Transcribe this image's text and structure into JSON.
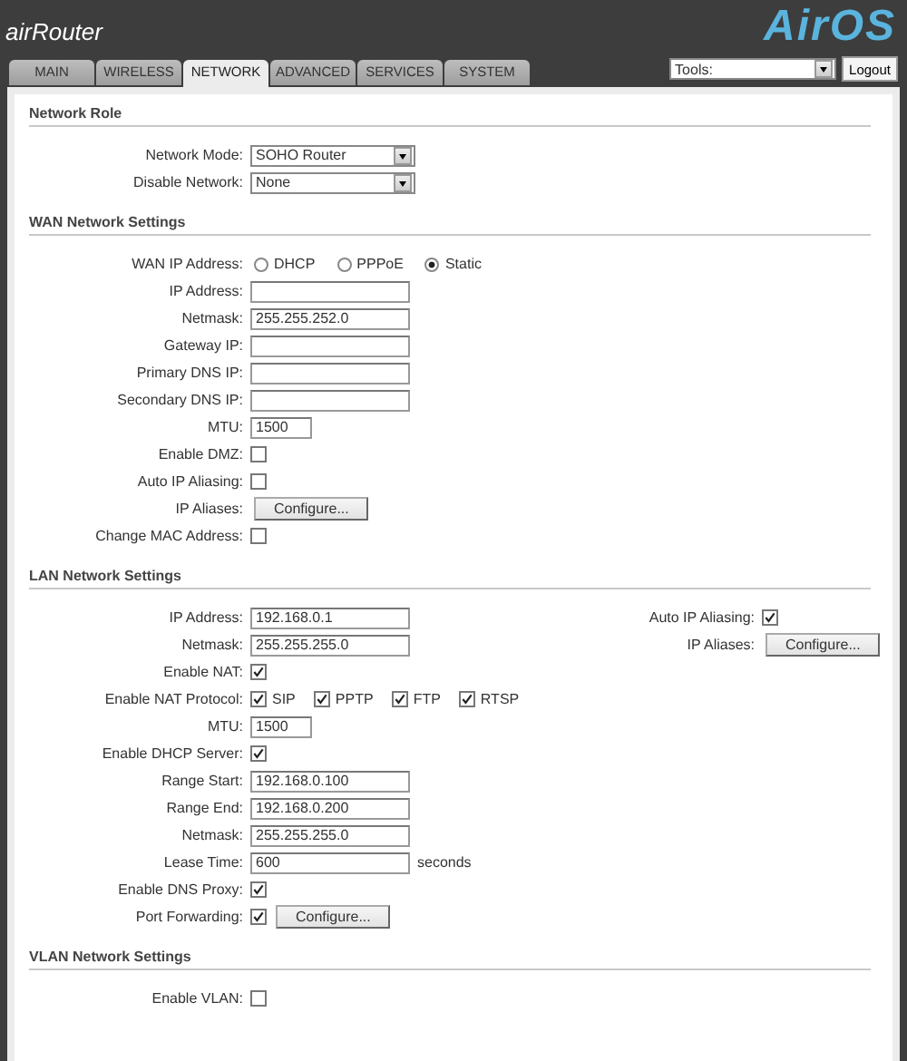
{
  "header": {
    "logo": "airRouter",
    "brand": "AirOS"
  },
  "tabs": [
    {
      "label": "MAIN",
      "selected": false
    },
    {
      "label": "WIRELESS",
      "selected": false
    },
    {
      "label": "NETWORK",
      "selected": true
    },
    {
      "label": "ADVANCED",
      "selected": false
    },
    {
      "label": "SERVICES",
      "selected": false
    },
    {
      "label": "SYSTEM",
      "selected": false
    }
  ],
  "tools": {
    "value": "Tools:"
  },
  "logout": "Logout",
  "sections": [
    {
      "title": "Network Role",
      "rows": [
        {
          "label": "Network Mode:",
          "kind": "select",
          "value": "SOHO Router"
        },
        {
          "label": "Disable Network:",
          "kind": "select",
          "value": "None"
        }
      ]
    },
    {
      "title": "WAN Network Settings",
      "rows": [
        {
          "label": "WAN IP Address:",
          "kind": "radio",
          "options": [
            {
              "label": "DHCP",
              "selected": false
            },
            {
              "label": "PPPoE",
              "selected": false
            },
            {
              "label": "Static",
              "selected": true
            }
          ]
        },
        {
          "label": "IP Address:",
          "kind": "text"
        },
        {
          "label": "Netmask:",
          "kind": "text",
          "value": "255.255.252.0"
        },
        {
          "label": "Gateway IP:",
          "kind": "text"
        },
        {
          "label": "Primary DNS IP:",
          "kind": "text"
        },
        {
          "label": "Secondary DNS IP:",
          "kind": "text"
        },
        {
          "label": "MTU:",
          "kind": "short",
          "value": "1500"
        },
        {
          "label": "Enable DMZ:",
          "kind": "checkbox",
          "checked": false
        },
        {
          "label": "Auto IP Aliasing:",
          "kind": "checkbox",
          "checked": false
        },
        {
          "label": "IP Aliases:",
          "kind": "button",
          "button": "Configure..."
        },
        {
          "label": "Change MAC Address:",
          "kind": "checkbox",
          "checked": false
        }
      ]
    },
    {
      "title": "LAN Network Settings",
      "rows": [
        {
          "label": "IP Address:",
          "kind": "text",
          "value": "192.168.0.1",
          "side": {
            "label": "Auto IP Aliasing:",
            "kind": "checkbox",
            "checked": true
          }
        },
        {
          "label": "Netmask:",
          "kind": "text",
          "value": "255.255.255.0",
          "side": {
            "label": "IP Aliases:",
            "kind": "button",
            "button": "Configure..."
          }
        },
        {
          "label": "Enable NAT:",
          "kind": "checkbox",
          "checked": true
        },
        {
          "label": "Enable NAT Protocol:",
          "kind": "checkgroup",
          "options": [
            {
              "label": "SIP",
              "checked": true
            },
            {
              "label": "PPTP",
              "checked": true
            },
            {
              "label": "FTP",
              "checked": true
            },
            {
              "label": "RTSP",
              "checked": true
            }
          ]
        },
        {
          "label": "MTU:",
          "kind": "short",
          "value": "1500"
        },
        {
          "label": "Enable DHCP Server:",
          "kind": "checkbox",
          "checked": true
        },
        {
          "label": "Range Start:",
          "kind": "text",
          "value": "192.168.0.100"
        },
        {
          "label": "Range End:",
          "kind": "text",
          "value": "192.168.0.200"
        },
        {
          "label": "Netmask:",
          "kind": "text",
          "value": "255.255.255.0"
        },
        {
          "label": "Lease Time:",
          "kind": "text",
          "value": "600",
          "unit": "seconds"
        },
        {
          "label": "Enable DNS Proxy:",
          "kind": "checkbox",
          "checked": true
        },
        {
          "label": "Port Forwarding:",
          "kind": "checkbox",
          "checked": true,
          "button": "Configure..."
        }
      ]
    },
    {
      "title": "VLAN Network Settings",
      "rows": [
        {
          "label": "Enable VLAN:",
          "kind": "checkbox",
          "checked": false
        }
      ]
    }
  ]
}
